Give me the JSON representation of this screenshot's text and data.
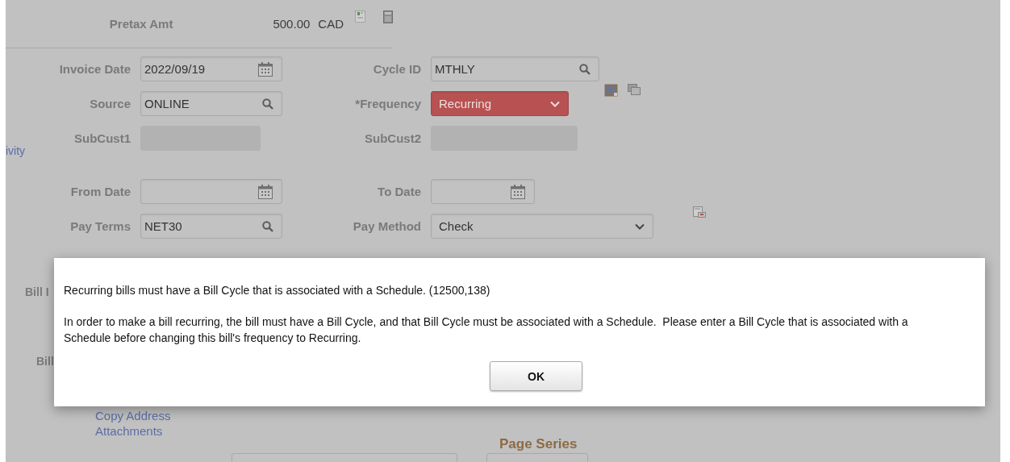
{
  "header": {
    "label": "Pretax Amt",
    "amount": "500.00",
    "currency": "CAD"
  },
  "side_link": "ivity",
  "rows": [
    {
      "left": {
        "label": "Invoice Date",
        "value": "2022/09/19",
        "kind": "date",
        "disabled": false,
        "error": false
      },
      "right": {
        "label": "Cycle ID",
        "value": "MTHLY",
        "kind": "lookup",
        "disabled": false,
        "error": false
      }
    },
    {
      "left": {
        "label": "Source",
        "value": "ONLINE",
        "kind": "lookup",
        "disabled": false,
        "error": false
      },
      "right": {
        "label": "*Frequency",
        "value": "Recurring",
        "kind": "select",
        "disabled": false,
        "error": true
      }
    },
    {
      "left": {
        "label": "SubCust1",
        "kind": "text",
        "disabled": true,
        "error": false
      },
      "right": {
        "label": "SubCust2",
        "kind": "text",
        "disabled": true,
        "error": false
      }
    },
    {
      "left": {
        "label": "From Date",
        "kind": "date",
        "disabled": false,
        "error": false
      },
      "right": {
        "label": "To Date",
        "kind": "date",
        "disabled": false,
        "error": false
      }
    },
    {
      "left": {
        "label": "Pay Terms",
        "value": "NET30",
        "kind": "lookup",
        "disabled": false,
        "error": false
      },
      "right": {
        "label": "Pay Method",
        "value": "Check",
        "kind": "select",
        "disabled": false,
        "error": false
      }
    }
  ],
  "hidden_labels": [
    "Bill I",
    "Bill"
  ],
  "links": [
    "Copy Address",
    "Attachments"
  ],
  "page_series": {
    "title": "Page Series"
  },
  "dialog": {
    "message": "Recurring bills must have a Bill Cycle that is associated with a Schedule. (12500,138)",
    "detail": "In order to make a bill recurring, the bill must have a Bill Cycle, and that Bill Cycle must be associated with a Schedule.  Please enter a Bill Cycle that is associated with a Schedule before changing this bill's frequency to Recurring.",
    "button": "OK"
  }
}
